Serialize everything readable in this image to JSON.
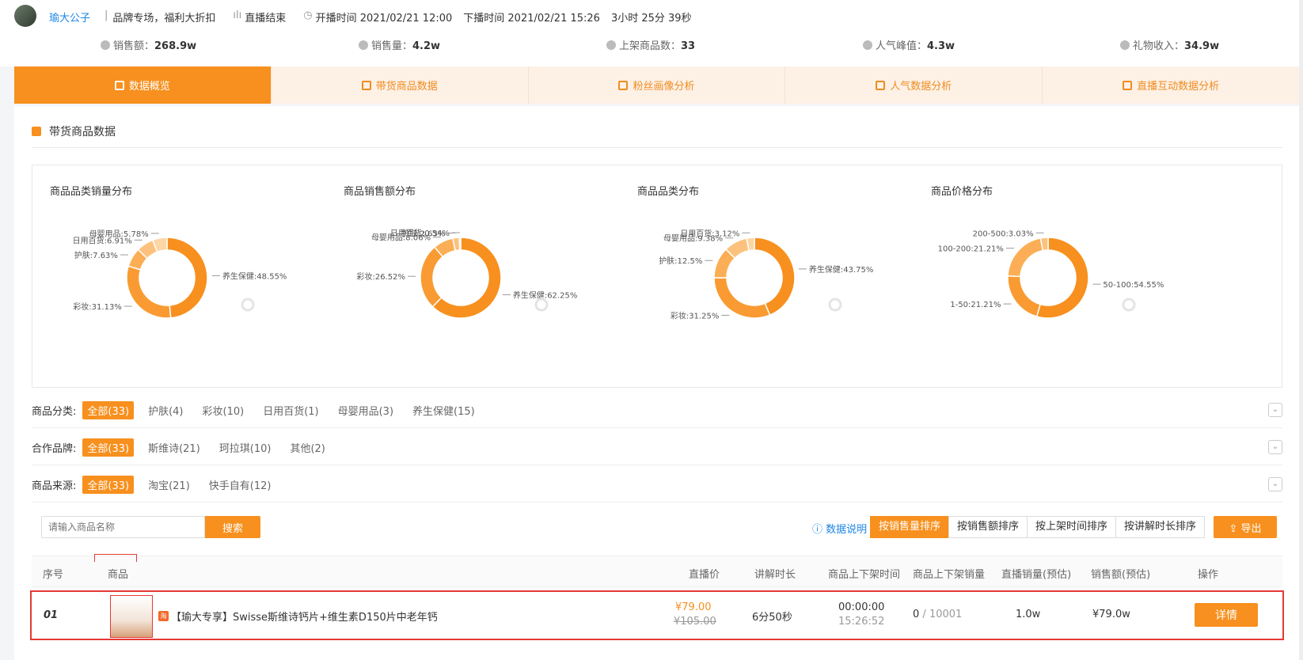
{
  "header": {
    "anchor_name": "瑜大公子",
    "slogan": "品牌专场，福利大折扣",
    "status": "直播结束",
    "start_time": "开播时间 2021/02/21 12:00",
    "end_time": "下播时间 2021/02/21 15:26",
    "duration": "3小时 25分 39秒"
  },
  "stats": [
    {
      "label": "销售额：",
      "value": "268.9w"
    },
    {
      "label": "销售量：",
      "value": "4.2w"
    },
    {
      "label": "上架商品数：",
      "value": "33"
    },
    {
      "label": "人气峰值：",
      "value": "4.3w"
    },
    {
      "label": "礼物收入：",
      "value": "34.9w"
    }
  ],
  "tabs": [
    "数据概览",
    "带货商品数据",
    "粉丝画像分析",
    "人气数据分析",
    "直播互动数据分析"
  ],
  "section_title": "带货商品数据",
  "chart_data": [
    {
      "type": "pie",
      "title": "商品品类销量分布",
      "slices": [
        {
          "label": "养生保健:48.55%",
          "value": 48.55
        },
        {
          "label": "彩妆:31.13%",
          "value": 31.13
        },
        {
          "label": "护肤:7.63%",
          "value": 7.63
        },
        {
          "label": "日用百货:6.91%",
          "value": 6.91
        },
        {
          "label": "母婴用品:5.78%",
          "value": 5.78
        }
      ]
    },
    {
      "type": "pie",
      "title": "商品销售额分布",
      "slices": [
        {
          "label": "养生保健:62.25%",
          "value": 62.25
        },
        {
          "label": "彩妆:26.52%",
          "value": 26.52
        },
        {
          "label": "母婴用品:8.06%",
          "value": 8.06
        },
        {
          "label": "护肤:2.63%",
          "value": 2.63
        },
        {
          "label": "日用百货:0.54%",
          "value": 0.54
        }
      ]
    },
    {
      "type": "pie",
      "title": "商品品类分布",
      "slices": [
        {
          "label": "养生保健:43.75%",
          "value": 43.75
        },
        {
          "label": "彩妆:31.25%",
          "value": 31.25
        },
        {
          "label": "护肤:12.5%",
          "value": 12.5
        },
        {
          "label": "母婴用品:9.38%",
          "value": 9.38
        },
        {
          "label": "日用百货:3.12%",
          "value": 3.12
        }
      ]
    },
    {
      "type": "pie",
      "title": "商品价格分布",
      "slices": [
        {
          "label": "50-100:54.55%",
          "value": 54.55
        },
        {
          "label": "1-50:21.21%",
          "value": 21.21
        },
        {
          "label": "100-200:21.21%",
          "value": 21.21
        },
        {
          "label": "200-500:3.03%",
          "value": 3.03
        }
      ]
    }
  ],
  "colors": {
    "accent": "#f7901e",
    "slices": [
      "#f7901e",
      "#f99b32",
      "#fbae55",
      "#fcc27d",
      "#fdd6a5"
    ]
  },
  "filters": [
    {
      "label": "商品分类:",
      "options": [
        "全部(33)",
        "护肤(4)",
        "彩妆(10)",
        "日用百货(1)",
        "母婴用品(3)",
        "养生保健(15)"
      ]
    },
    {
      "label": "合作品牌:",
      "options": [
        "全部(33)",
        "斯维诗(21)",
        "珂拉琪(10)",
        "其他(2)"
      ]
    },
    {
      "label": "商品来源:",
      "options": [
        "全部(33)",
        "淘宝(21)",
        "快手自有(12)"
      ]
    }
  ],
  "search": {
    "placeholder": "请输入商品名称",
    "button": "搜索"
  },
  "help_label": "数据说明",
  "sorts": [
    "按销售量排序",
    "按销售额排序",
    "按上架时间排序",
    "按讲解时长排序"
  ],
  "export_label": "导出",
  "table": {
    "headers": [
      "序号",
      "商品",
      "直播价",
      "讲解时长",
      "商品上下架时间",
      "商品上下架销量",
      "直播销量(预估)",
      "销售额(预估)",
      "操作"
    ],
    "rows": [
      {
        "index": "01",
        "name": "【瑜大专享】Swisse斯维诗钙片+维生素D150片中老年钙",
        "price": "¥79.00",
        "orig_price": "¥105.00",
        "explain": "6分50秒",
        "time_on": "00:00:00",
        "time_off": "15:26:52",
        "stock_sold": "0",
        "stock_sep": " / ",
        "stock_total": "10001",
        "live_sales": "1.0w",
        "revenue": "¥79.0w",
        "action": "详情"
      }
    ]
  }
}
